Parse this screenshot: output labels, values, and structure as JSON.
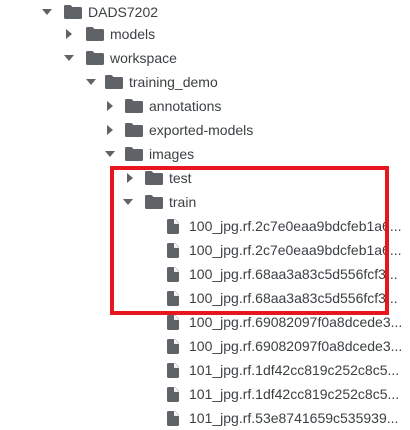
{
  "tree": {
    "root": {
      "label": "DADS7202",
      "icon": "folder-icon",
      "state": "expanded"
    },
    "models": {
      "label": "models",
      "icon": "folder-icon",
      "state": "collapsed"
    },
    "workspace": {
      "label": "workspace",
      "icon": "folder-icon",
      "state": "expanded"
    },
    "training_demo": {
      "label": "training_demo",
      "icon": "folder-icon",
      "state": "expanded"
    },
    "annotations": {
      "label": "annotations",
      "icon": "folder-icon",
      "state": "collapsed"
    },
    "exported_models": {
      "label": "exported-models",
      "icon": "folder-icon",
      "state": "collapsed"
    },
    "images": {
      "label": "images",
      "icon": "folder-icon",
      "state": "expanded"
    },
    "test": {
      "label": "test",
      "icon": "folder-icon",
      "state": "collapsed"
    },
    "train": {
      "label": "train",
      "icon": "folder-icon",
      "state": "expanded"
    },
    "files": [
      "100_jpg.rf.2c7e0eaa9bdcfeb1a6...",
      "100_jpg.rf.2c7e0eaa9bdcfeb1a6...",
      "100_jpg.rf.68aa3a83c5d556fcf3...",
      "100_jpg.rf.68aa3a83c5d556fcf3...",
      "100_jpg.rf.69082097f0a8dcede3...",
      "100_jpg.rf.69082097f0a8dcede3...",
      "101_jpg.rf.1df42cc819c252c8c5...",
      "101_jpg.rf.1df42cc819c252c8c5...",
      "101_jpg.rf.53e8741659c535939..."
    ]
  },
  "colors": {
    "folder": "#5f6368",
    "file": "#5f6368",
    "arrow": "#5f6368",
    "text": "#3c4043",
    "highlight_box": "#e8161d"
  }
}
